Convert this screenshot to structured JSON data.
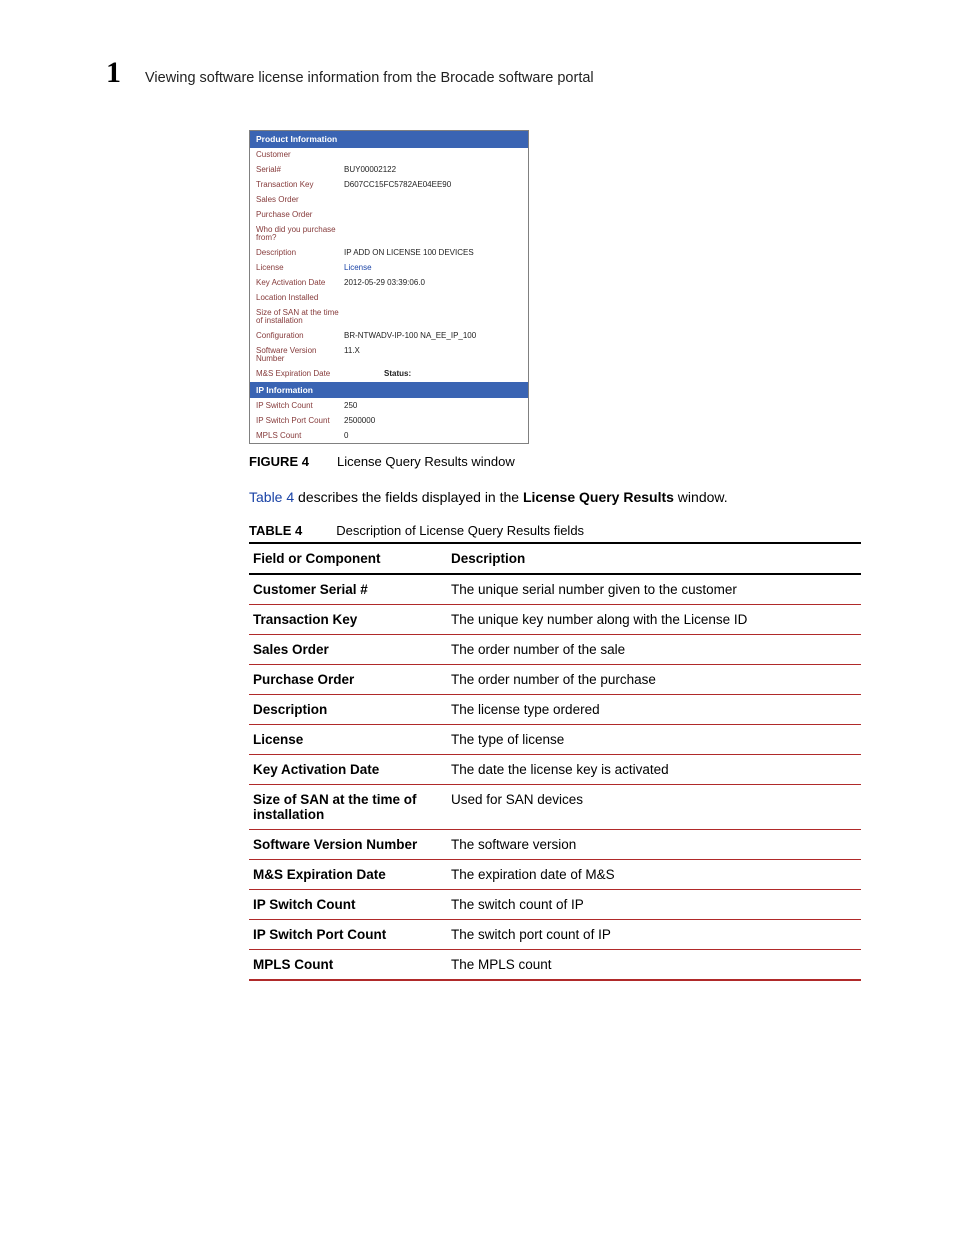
{
  "header": {
    "chapter_number": "1",
    "chapter_title": "Viewing software license information from the Brocade software portal"
  },
  "figure": {
    "caption_label": "FIGURE 4",
    "caption_text": "License Query Results window",
    "product_info_header": "Product Information",
    "ip_info_header": "IP Information",
    "rows": [
      {
        "label": "Customer",
        "value": ""
      },
      {
        "label": "Serial#",
        "value": "BUY00002122"
      },
      {
        "label": "Transaction Key",
        "value": "D607CC15FC5782AE04EE90"
      },
      {
        "label": "Sales Order",
        "value": ""
      },
      {
        "label": "Purchase Order",
        "value": ""
      },
      {
        "label": "Who did you purchase from?",
        "value": ""
      },
      {
        "label": "Description",
        "value": "IP ADD ON LICENSE 100 DEVICES"
      },
      {
        "label": "License",
        "value": "License",
        "link": true
      },
      {
        "label": "Key Activation Date",
        "value": "2012-05-29 03:39:06.0"
      },
      {
        "label": "Location Installed",
        "value": ""
      },
      {
        "label": "Size of SAN at the time of installation",
        "value": ""
      },
      {
        "label": "Configuration",
        "value": "BR-NTWADV-IP-100    NA_EE_IP_100"
      },
      {
        "label": "Software Version Number",
        "value": "11.X"
      }
    ],
    "status_row": {
      "label": "M&S Expiration Date",
      "status_label": "Status:"
    },
    "ip_rows": [
      {
        "label": "IP Switch Count",
        "value": "250"
      },
      {
        "label": "IP Switch Port Count",
        "value": "2500000"
      },
      {
        "label": "MPLS Count",
        "value": "0"
      }
    ]
  },
  "intro": {
    "link_text": "Table 4",
    "mid_text": " describes the fields displayed in the ",
    "bold_text": "License Query Results",
    "end_text": " window."
  },
  "table": {
    "caption_label": "TABLE 4",
    "caption_text": "Description of License Query Results fields",
    "headers": {
      "field": "Field or Component",
      "desc": "Description"
    },
    "rows": [
      {
        "field": "Customer Serial #",
        "desc": "The unique serial number given to the customer"
      },
      {
        "field": "Transaction Key",
        "desc": "The unique key number along with the License ID"
      },
      {
        "field": "Sales Order",
        "desc": "The order number of the sale"
      },
      {
        "field": "Purchase Order",
        "desc": "The order number of the purchase"
      },
      {
        "field": "Description",
        "desc": "The license type ordered"
      },
      {
        "field": "License",
        "desc": "The type of license"
      },
      {
        "field": "Key Activation Date",
        "desc": "The date the license key is activated"
      },
      {
        "field": "Size of SAN at the time of installation",
        "desc": "Used for SAN devices"
      },
      {
        "field": "Software Version Number",
        "desc": "The software version"
      },
      {
        "field": "M&S Expiration Date",
        "desc": "The expiration date of M&S"
      },
      {
        "field": "IP Switch Count",
        "desc": "The switch count of IP"
      },
      {
        "field": "IP Switch Port Count",
        "desc": "The switch port count of IP"
      },
      {
        "field": "MPLS Count",
        "desc": "The MPLS count"
      }
    ]
  }
}
